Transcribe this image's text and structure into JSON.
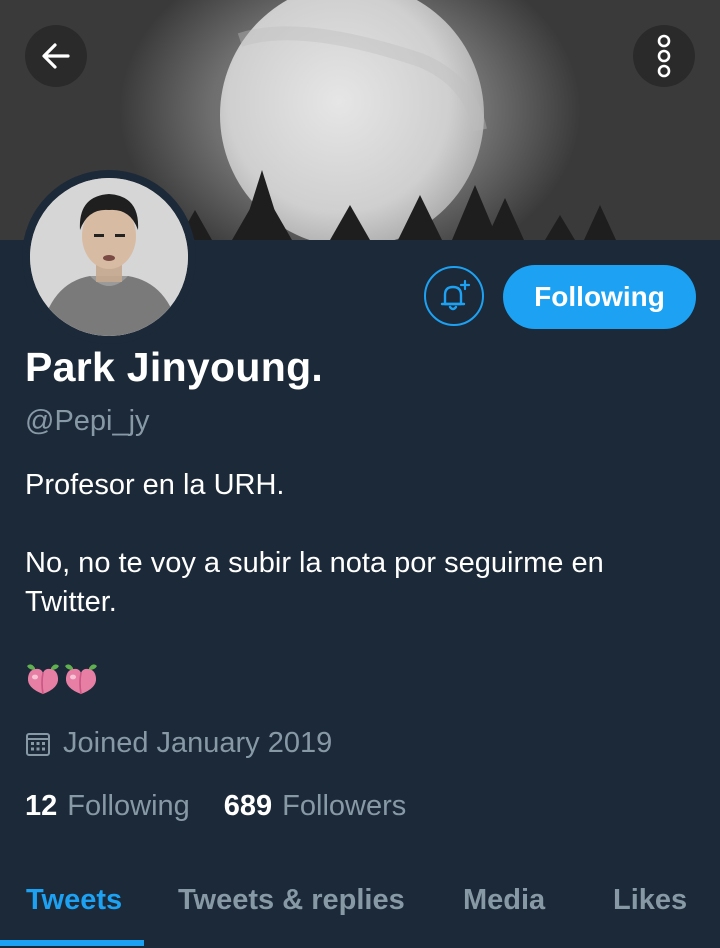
{
  "profile": {
    "name": "Park Jinyoung.",
    "handle": "@Pepi_jy",
    "bio": "Profesor en la URH.\n\nNo, no te voy a subir la nota por seguirme en Twitter.",
    "joined": "Joined January 2019",
    "following_count": "12",
    "following_label": "Following",
    "followers_count": "689",
    "followers_label": "Followers"
  },
  "actions": {
    "follow_label": "Following"
  },
  "icons": {
    "back": "back-arrow-icon",
    "more": "more-vertical-icon",
    "bell": "bell-plus-icon",
    "calendar": "calendar-icon",
    "emoji": "peach-emoji"
  },
  "tabs": [
    {
      "label": "Tweets",
      "active": true
    },
    {
      "label": "Tweets & replies",
      "active": false
    },
    {
      "label": "Media",
      "active": false
    },
    {
      "label": "Likes",
      "active": false
    }
  ],
  "colors": {
    "background": "#1c2938",
    "accent": "#1da1f2",
    "secondary_text": "#8899a6"
  }
}
